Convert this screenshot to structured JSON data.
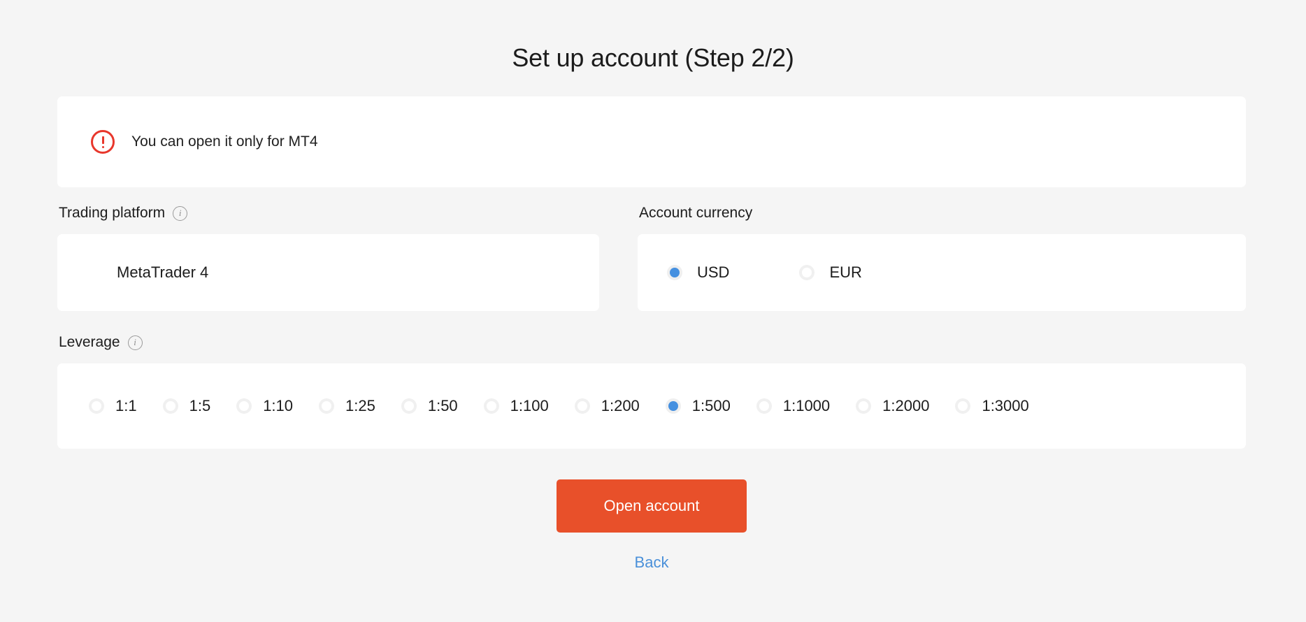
{
  "page": {
    "title": "Set up account (Step 2/2)",
    "background_color": "#f5f5f5"
  },
  "alert": {
    "icon": "error-circle-icon",
    "message": "You can open it only for MT4",
    "color": "#e8372c"
  },
  "trading_platform": {
    "label": "Trading platform",
    "info_icon": "info-icon",
    "info_glyph": "i",
    "value": "MetaTrader 4"
  },
  "account_currency": {
    "label": "Account currency",
    "selected": "USD",
    "options": [
      {
        "label": "USD",
        "selected": true
      },
      {
        "label": "EUR",
        "selected": false
      }
    ]
  },
  "leverage": {
    "label": "Leverage",
    "info_icon": "info-icon",
    "info_glyph": "i",
    "selected": "1:500",
    "options": [
      {
        "label": "1:1",
        "selected": false
      },
      {
        "label": "1:5",
        "selected": false
      },
      {
        "label": "1:10",
        "selected": false
      },
      {
        "label": "1:25",
        "selected": false
      },
      {
        "label": "1:50",
        "selected": false
      },
      {
        "label": "1:100",
        "selected": false
      },
      {
        "label": "1:200",
        "selected": false
      },
      {
        "label": "1:500",
        "selected": true
      },
      {
        "label": "1:1000",
        "selected": false
      },
      {
        "label": "1:2000",
        "selected": false
      },
      {
        "label": "1:3000",
        "selected": false
      }
    ]
  },
  "actions": {
    "submit_label": "Open account",
    "submit_color": "#e8502a",
    "back_label": "Back",
    "back_color": "#4a90d9"
  },
  "colors": {
    "accent_orange": "#e8502a",
    "link_blue": "#4a90d9",
    "radio_selected": "#4590e0",
    "alert_red": "#e8372c",
    "card_white": "#ffffff"
  }
}
